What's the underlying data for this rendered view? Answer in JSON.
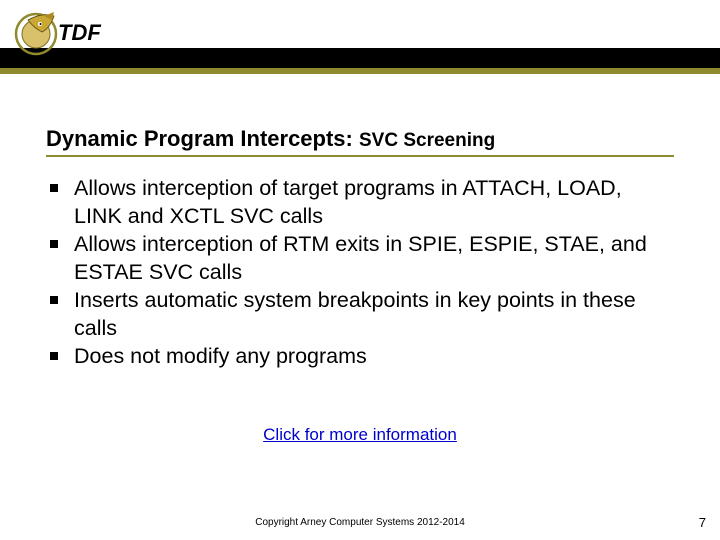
{
  "header": {
    "logo_text": "TDF"
  },
  "title": {
    "main": "Dynamic Program Intercepts: ",
    "sub": "SVC Screening"
  },
  "bullets": [
    "Allows interception of target programs in ATTACH, LOAD, LINK and XCTL SVC calls",
    "Allows interception of RTM exits in SPIE, ESPIE, STAE, and ESTAE SVC calls",
    "Inserts automatic system breakpoints in key points in these calls",
    "Does not modify any programs"
  ],
  "link_text": "Click for more information",
  "copyright": "Copyright Arney Computer Systems 2012-2014",
  "page_number": "7"
}
